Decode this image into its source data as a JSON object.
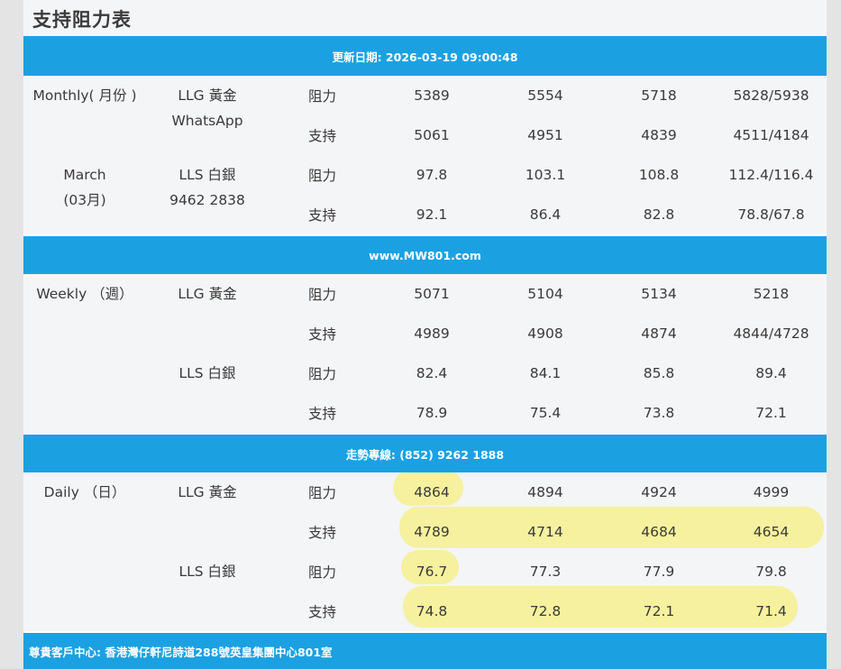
{
  "title": "支持阻力表",
  "banners": {
    "update": "更新日期: 2026-03-19 09:00:48",
    "site": "www.MW801.com",
    "hotline": "走勢專線: (852) 9262 1888",
    "address": "尊貴客戶中心: 香港灣仔軒尼詩道288號英皇集團中心801室"
  },
  "monthly": {
    "period_line1": "Monthly( 月份 )",
    "period_line2": "March",
    "period_line3": "(03月)",
    "gold_label": "LLG 黃金",
    "whatsapp": "WhatsApp",
    "silver_label": "LLS 白銀",
    "phone": "9462 2838",
    "rows": [
      {
        "kind": "阻力",
        "v": [
          "5389",
          "5554",
          "5718",
          "5828/5938"
        ]
      },
      {
        "kind": "支持",
        "v": [
          "5061",
          "4951",
          "4839",
          "4511/4184"
        ]
      },
      {
        "kind": "阻力",
        "v": [
          "97.8",
          "103.1",
          "108.8",
          "112.4/116.4"
        ]
      },
      {
        "kind": "支持",
        "v": [
          "92.1",
          "86.4",
          "82.8",
          "78.8/67.8"
        ]
      }
    ]
  },
  "weekly": {
    "period": "Weekly （週）",
    "gold_label": "LLG 黃金",
    "silver_label": "LLS 白銀",
    "rows": [
      {
        "kind": "阻力",
        "v": [
          "5071",
          "5104",
          "5134",
          "5218"
        ]
      },
      {
        "kind": "支持",
        "v": [
          "4989",
          "4908",
          "4874",
          "4844/4728"
        ]
      },
      {
        "kind": "阻力",
        "v": [
          "82.4",
          "84.1",
          "85.8",
          "89.4"
        ]
      },
      {
        "kind": "支持",
        "v": [
          "78.9",
          "75.4",
          "73.8",
          "72.1"
        ]
      }
    ]
  },
  "daily": {
    "period": "Daily （日）",
    "gold_label": "LLG 黃金",
    "silver_label": "LLS 白銀",
    "rows": [
      {
        "kind": "阻力",
        "v": [
          "4864",
          "4894",
          "4924",
          "4999"
        ]
      },
      {
        "kind": "支持",
        "v": [
          "4789",
          "4714",
          "4684",
          "4654"
        ]
      },
      {
        "kind": "阻力",
        "v": [
          "76.7",
          "77.3",
          "77.9",
          "79.8"
        ]
      },
      {
        "kind": "支持",
        "v": [
          "74.8",
          "72.8",
          "72.1",
          "71.4"
        ]
      }
    ]
  },
  "highlight_color": "#f5f08a",
  "banner_color": "#1ba1e2"
}
